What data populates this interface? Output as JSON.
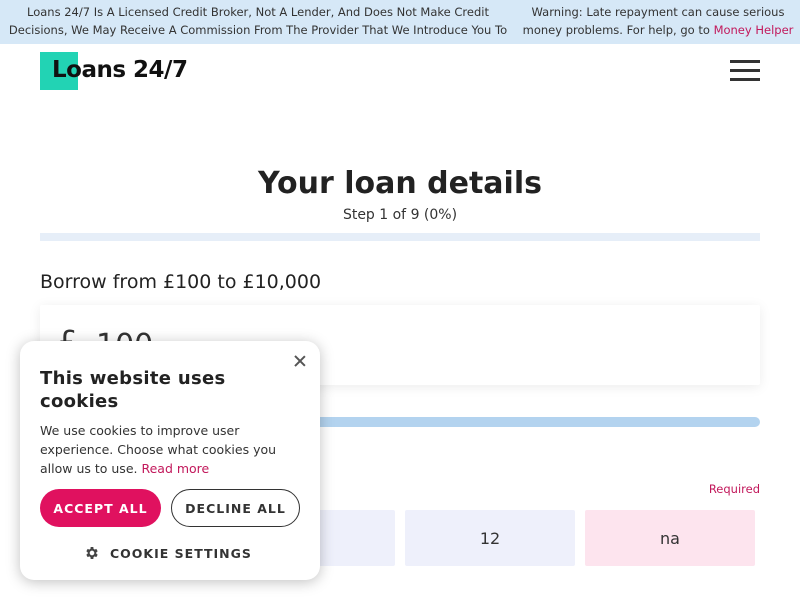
{
  "banner": {
    "disclaimer_line1": "Loans 24/7 Is A Licensed Credit Broker, Not A Lender, And Does Not Make Credit",
    "disclaimer_line2": "Decisions, We May Receive A Commission From The Provider That We Introduce You To",
    "warning_line1": "Warning: Late repayment can cause serious",
    "warning_line2": "money problems. For help, go to",
    "warning_link": "Money Helper"
  },
  "header": {
    "logo_text": "Loans 24/7",
    "menu_icon": "hamburger-icon"
  },
  "form": {
    "title": "Your loan details",
    "step_text": "Step 1 of 9 (0%)",
    "progress_percent": 0,
    "borrow_label": "Borrow from £100 to £10,000",
    "currency_symbol": "£",
    "amount_value": "100",
    "required_label": "Required",
    "term_options": [
      "",
      "12",
      "na"
    ]
  },
  "cookie_banner": {
    "title": "This website uses cookies",
    "body": "We use cookies to improve user experience. Choose what cookies you allow us to use.",
    "read_more": "Read more",
    "accept_label": "ACCEPT ALL",
    "decline_label": "DECLINE ALL",
    "settings_label": "COOKIE SETTINGS",
    "close_icon": "close-icon",
    "settings_icon": "gear-icon"
  },
  "colors": {
    "banner_bg": "#d6e8f7",
    "accent_pink": "#e0115f",
    "link_pink": "#c2185b",
    "logo_teal": "#22d3b4",
    "slider_blue": "#b3d3ef"
  }
}
